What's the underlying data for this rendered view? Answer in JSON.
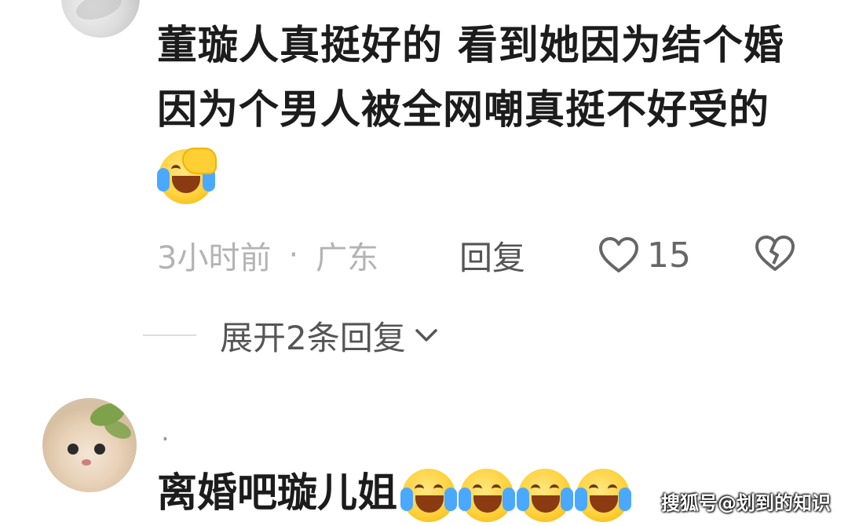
{
  "comment1": {
    "text_part1": "董璇人真挺好的 看到她因为结个婚因为个男人被全网嘲真挺不好受的",
    "emoji": "facepalm-laughing-crying-emoji",
    "time": "3小时前",
    "separator": "·",
    "location": "广东",
    "reply_label": "回复",
    "like_count": "15"
  },
  "expand": {
    "label": "展开2条回复"
  },
  "comment2": {
    "name": ".",
    "text": "离婚吧璇儿姐",
    "emojis": [
      "laughing-crying-emoji",
      "laughing-crying-emoji",
      "laughing-crying-emoji",
      "laughing-crying-emoji"
    ]
  },
  "watermark": "搜狐号@划到的知识",
  "colors": {
    "text": "#1c1c1c",
    "meta": "#b3b3b3",
    "reply": "#555555",
    "tear": "#4aa9ff",
    "emoji_yellow": "#ffd23f"
  }
}
